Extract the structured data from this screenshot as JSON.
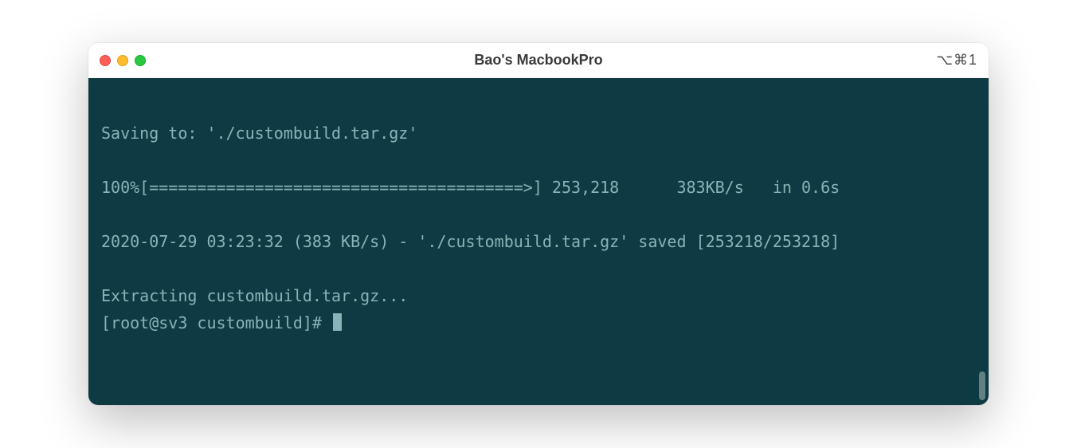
{
  "titlebar": {
    "title": "Bao's MacbookPro",
    "shortcut": "⌥⌘1"
  },
  "terminal": {
    "line1": "Saving to: './custombuild.tar.gz'",
    "blank1": "",
    "line2": "100%[=======================================>] 253,218      383KB/s   in 0.6s",
    "blank2": "",
    "line3": "2020-07-29 03:23:32 (383 KB/s) - './custombuild.tar.gz' saved [253218/253218]",
    "blank3": "",
    "line4": "Extracting custombuild.tar.gz...",
    "prompt": "[root@sv3 custombuild]# "
  }
}
